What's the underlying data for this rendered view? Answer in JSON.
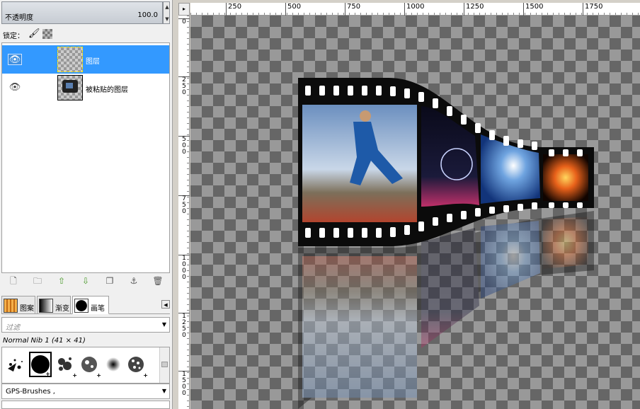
{
  "layers_panel": {
    "opacity_label": "不透明度",
    "opacity_value": "100.0",
    "lock_label": "锁定：",
    "layers": [
      {
        "name": "图层",
        "selected": true
      },
      {
        "name": "被粘贴的图层",
        "selected": false
      }
    ]
  },
  "brushes_panel": {
    "tabs": [
      {
        "label": "图案"
      },
      {
        "label": "渐变"
      },
      {
        "label": "画笔",
        "active": true
      }
    ],
    "filter_placeholder": "过滤",
    "brush_name": "Normal Nib 1 (41 × 41)",
    "tag_value": "GPS-Brushes ,"
  },
  "rulers": {
    "horizontal": [
      "250",
      "500",
      "750",
      "1000",
      "1250",
      "1500",
      "1750"
    ],
    "vertical": [
      "0",
      "250",
      "500",
      "750",
      "1000",
      "1250",
      "1500"
    ]
  }
}
